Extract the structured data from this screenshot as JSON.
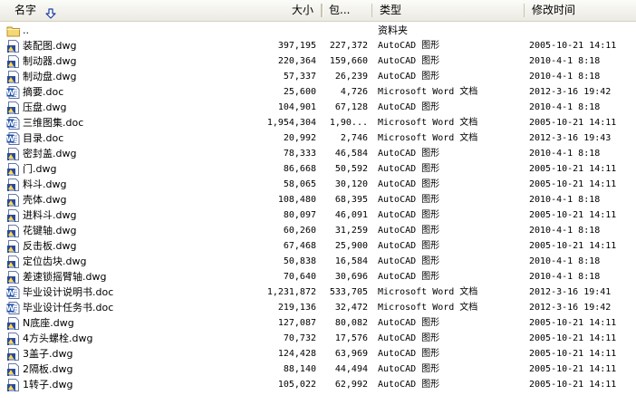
{
  "header": {
    "name": "名字",
    "size": "大小",
    "packed": "包...",
    "type": "类型",
    "modified": "修改时间"
  },
  "colors": {
    "header_bg": "#ebeae3",
    "folder": "#e8c860",
    "dwg_blue": "#2a4a9a",
    "doc_blue": "#1f4fa8"
  },
  "rows": [
    {
      "icon": "folder-icon",
      "name": "..",
      "size": "",
      "packed": "",
      "type": "资料夹",
      "modified": ""
    },
    {
      "icon": "dwg-file-icon",
      "name": "装配图.dwg",
      "size": "397,195",
      "packed": "227,372",
      "type": "AutoCAD 图形",
      "modified": "2005-10-21 14:11"
    },
    {
      "icon": "dwg-file-icon",
      "name": "制动器.dwg",
      "size": "220,364",
      "packed": "159,660",
      "type": "AutoCAD 图形",
      "modified": "2010-4-1 8:18"
    },
    {
      "icon": "dwg-file-icon",
      "name": "制动盘.dwg",
      "size": "57,337",
      "packed": "26,239",
      "type": "AutoCAD 图形",
      "modified": "2010-4-1 8:18"
    },
    {
      "icon": "doc-file-icon",
      "name": "摘要.doc",
      "size": "25,600",
      "packed": "4,726",
      "type": "Microsoft Word 文档",
      "modified": "2012-3-16 19:42"
    },
    {
      "icon": "dwg-file-icon",
      "name": "压盘.dwg",
      "size": "104,901",
      "packed": "67,128",
      "type": "AutoCAD 图形",
      "modified": "2010-4-1 8:18"
    },
    {
      "icon": "doc-file-icon",
      "name": "三维图集.doc",
      "size": "1,954,304",
      "packed": "1,90...",
      "type": "Microsoft Word 文档",
      "modified": "2005-10-21 14:11"
    },
    {
      "icon": "doc-file-icon",
      "name": "目录.doc",
      "size": "20,992",
      "packed": "2,746",
      "type": "Microsoft Word 文档",
      "modified": "2012-3-16 19:43"
    },
    {
      "icon": "dwg-file-icon",
      "name": "密封盖.dwg",
      "size": "78,333",
      "packed": "46,584",
      "type": "AutoCAD 图形",
      "modified": "2010-4-1 8:18"
    },
    {
      "icon": "dwg-file-icon",
      "name": "门.dwg",
      "size": "86,668",
      "packed": "50,592",
      "type": "AutoCAD 图形",
      "modified": "2005-10-21 14:11"
    },
    {
      "icon": "dwg-file-icon",
      "name": "料斗.dwg",
      "size": "58,065",
      "packed": "30,120",
      "type": "AutoCAD 图形",
      "modified": "2005-10-21 14:11"
    },
    {
      "icon": "dwg-file-icon",
      "name": "壳体.dwg",
      "size": "108,480",
      "packed": "68,395",
      "type": "AutoCAD 图形",
      "modified": "2010-4-1 8:18"
    },
    {
      "icon": "dwg-file-icon",
      "name": "进料斗.dwg",
      "size": "80,097",
      "packed": "46,091",
      "type": "AutoCAD 图形",
      "modified": "2005-10-21 14:11"
    },
    {
      "icon": "dwg-file-icon",
      "name": "花键轴.dwg",
      "size": "60,260",
      "packed": "31,259",
      "type": "AutoCAD 图形",
      "modified": "2010-4-1 8:18"
    },
    {
      "icon": "dwg-file-icon",
      "name": "反击板.dwg",
      "size": "67,468",
      "packed": "25,900",
      "type": "AutoCAD 图形",
      "modified": "2005-10-21 14:11"
    },
    {
      "icon": "dwg-file-icon",
      "name": "定位齿块.dwg",
      "size": "50,838",
      "packed": "16,584",
      "type": "AutoCAD 图形",
      "modified": "2010-4-1 8:18"
    },
    {
      "icon": "dwg-file-icon",
      "name": "差速锁摇臂轴.dwg",
      "size": "70,640",
      "packed": "30,696",
      "type": "AutoCAD 图形",
      "modified": "2010-4-1 8:18"
    },
    {
      "icon": "doc-file-icon",
      "name": "毕业设计说明书.doc",
      "size": "1,231,872",
      "packed": "533,705",
      "type": "Microsoft Word 文档",
      "modified": "2012-3-16 19:41"
    },
    {
      "icon": "doc-file-icon",
      "name": "毕业设计任务书.doc",
      "size": "219,136",
      "packed": "32,472",
      "type": "Microsoft Word 文档",
      "modified": "2012-3-16 19:42"
    },
    {
      "icon": "dwg-file-icon",
      "name": "N底座.dwg",
      "size": "127,087",
      "packed": "80,082",
      "type": "AutoCAD 图形",
      "modified": "2005-10-21 14:11"
    },
    {
      "icon": "dwg-file-icon",
      "name": "4方头螺栓.dwg",
      "size": "70,732",
      "packed": "17,576",
      "type": "AutoCAD 图形",
      "modified": "2005-10-21 14:11"
    },
    {
      "icon": "dwg-file-icon",
      "name": "3盖子.dwg",
      "size": "124,428",
      "packed": "63,969",
      "type": "AutoCAD 图形",
      "modified": "2005-10-21 14:11"
    },
    {
      "icon": "dwg-file-icon",
      "name": "2隔板.dwg",
      "size": "88,140",
      "packed": "44,494",
      "type": "AutoCAD 图形",
      "modified": "2005-10-21 14:11"
    },
    {
      "icon": "dwg-file-icon",
      "name": "1转子.dwg",
      "size": "105,022",
      "packed": "62,992",
      "type": "AutoCAD 图形",
      "modified": "2005-10-21 14:11"
    }
  ]
}
